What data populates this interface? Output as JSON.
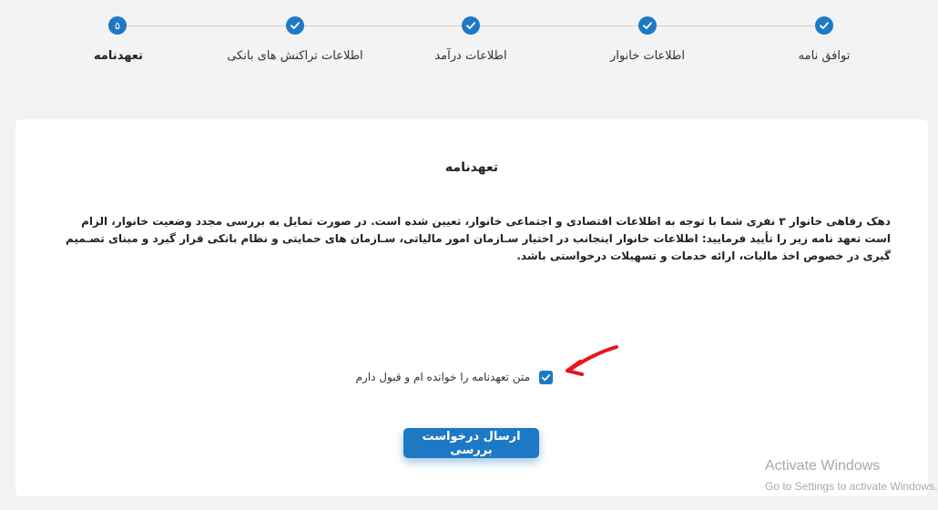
{
  "stepper": {
    "steps": [
      {
        "label": "توافق نامه",
        "state": "done"
      },
      {
        "label": "اطلاعات خانوار",
        "state": "done"
      },
      {
        "label": "اطلاعات درآمد",
        "state": "done"
      },
      {
        "label": "اطلاعات تراکنش های بانکی",
        "state": "done"
      },
      {
        "label": "تعهدنامه",
        "state": "active",
        "number": "۵"
      }
    ]
  },
  "card": {
    "title": "تعهدنامه",
    "paragraph": "دهک رفاهی خانوار ۳ نفری شما با توجه به اطلاعات اقتصادی و اجتماعی خانوار، تعیین شده است. در صورت تمایل به بررسی مجدد وضعیت خانوار، الزام است تعهد نامه زیر را تأیید فرمایید: اطلاعات خانوار اینجانب در اختیار سـازمان امور مالیاتی، سـازمان های حمایتی و نظام بانکی قرار گیرد و مبنای تصـمیم گیری در خصوص اخذ مالیات، ارائه خدمات و تسهیلات درخواستی باشد.",
    "agree_label": "متن تعهدنامه را خوانده ام و قبول دارم",
    "agree_checked": true,
    "submit_label": "ارسال درخواست بررسی"
  },
  "watermark": {
    "title": "Activate Windows",
    "subtitle": "Go to Settings to activate Windows."
  },
  "colors": {
    "accent": "#1e79c4",
    "annotation_arrow": "#e8141c"
  }
}
